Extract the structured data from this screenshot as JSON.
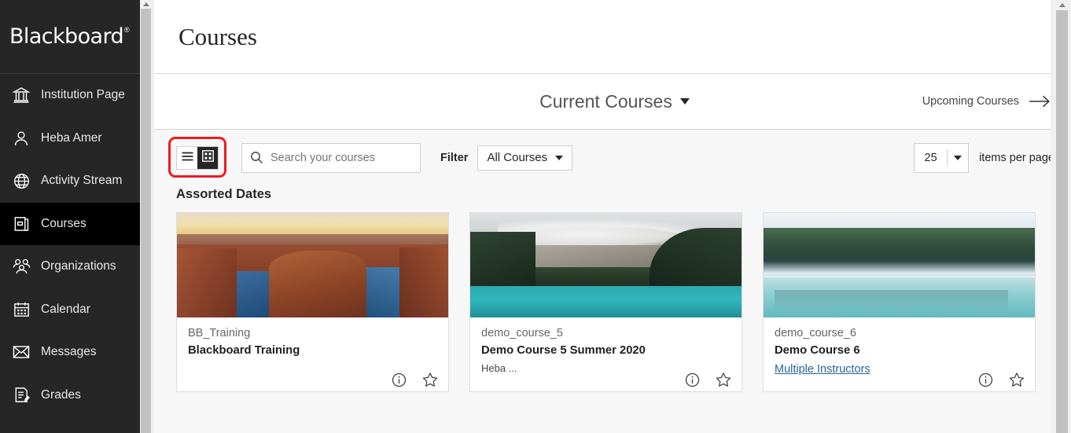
{
  "brand": {
    "name": "Blackboard",
    "trademark": "®"
  },
  "sidebar": {
    "items": [
      {
        "label": "Institution Page",
        "icon": "bank-icon",
        "active": false
      },
      {
        "label": "Heba Amer",
        "icon": "person-icon",
        "active": false
      },
      {
        "label": "Activity Stream",
        "icon": "globe-icon",
        "active": false
      },
      {
        "label": "Courses",
        "icon": "book-icon",
        "active": true
      },
      {
        "label": "Organizations",
        "icon": "people-group-icon",
        "active": false
      },
      {
        "label": "Calendar",
        "icon": "calendar-icon",
        "active": false
      },
      {
        "label": "Messages",
        "icon": "envelope-icon",
        "active": false
      },
      {
        "label": "Grades",
        "icon": "document-pencil-icon",
        "active": false
      }
    ]
  },
  "header": {
    "title": "Courses"
  },
  "term_bar": {
    "current_term": "Current Courses",
    "upcoming_label": "Upcoming Courses"
  },
  "toolbar": {
    "view_list_label": "List view",
    "view_grid_label": "Grid view",
    "active_view": "grid",
    "search": {
      "placeholder": "Search your courses",
      "value": ""
    },
    "filter_label": "Filter",
    "filter_value": "All Courses",
    "items_per_page_value": "25",
    "items_per_page_label": "items per page"
  },
  "annotation": {
    "color": "#ee1b24",
    "target": "view-toggle"
  },
  "groups": [
    {
      "title": "Assorted Dates",
      "courses": [
        {
          "id": "BB_Training",
          "name": "Blackboard Training",
          "instructor": "",
          "instructor_is_link": false,
          "image": "canyon-river-sunset",
          "info_icon": "info-circle-icon",
          "favorite_icon": "star-outline-icon"
        },
        {
          "id": "demo_course_5",
          "name": "Demo Course 5 Summer 2020",
          "instructor": "Heba ...",
          "instructor_is_link": false,
          "image": "mountain-turquoise-lake",
          "info_icon": "info-circle-icon",
          "favorite_icon": "star-outline-icon"
        },
        {
          "id": "demo_course_6",
          "name": "Demo Course 6",
          "instructor": "Multiple Instructors",
          "instructor_is_link": true,
          "image": "misty-forest-lake",
          "info_icon": "info-circle-icon",
          "favorite_icon": "star-outline-icon"
        }
      ]
    }
  ],
  "colors": {
    "sidebar_bg": "#262626",
    "sidebar_active_bg": "#000000",
    "accent_link": "#2a6496",
    "annotation_red": "#ee1b24",
    "page_bg": "#f7f7f7"
  }
}
